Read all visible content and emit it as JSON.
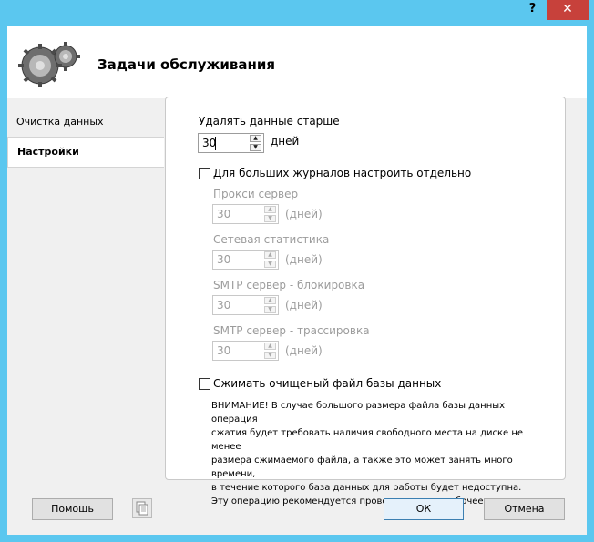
{
  "window": {
    "help_glyph": "?",
    "close_glyph": "✕"
  },
  "header": {
    "title": "Задачи обслуживания"
  },
  "sidebar": {
    "items": [
      {
        "label": "Очистка данных"
      },
      {
        "label": "Настройки"
      }
    ]
  },
  "settings": {
    "delete_older_label": "Удалять данные старше",
    "delete_older_value": "30",
    "days_label": "дней",
    "separate_logs_label": "Для больших журналов настроить отдельно",
    "separate_logs_checked": false,
    "proxy_label": "Прокси сервер",
    "proxy_value": "30",
    "netstat_label": "Сетевая статистика",
    "netstat_value": "30",
    "smtp_block_label": "SMTP сервер - блокировка",
    "smtp_block_value": "30",
    "smtp_trace_label": "SMTP сервер - трассировка",
    "smtp_trace_value": "30",
    "days_paren_label": "(дней)",
    "compress_label": "Сжимать очищеный файл базы данных",
    "compress_checked": false,
    "warning_lines": [
      "ВНИМАНИЕ! В случае большого размера файла базы данных  операция",
      "сжатия будет требовать наличия свободного места на диске не менее",
      "размера сжимаемого файла, а также это может занять много времени,",
      "в течение которого база данных для работы будет недоступна.",
      "Эту операцию рекомендуется проводить во внерабочее время."
    ]
  },
  "footer": {
    "help_label": "Помощь",
    "ok_label": "ОК",
    "cancel_label": "Отмена"
  }
}
